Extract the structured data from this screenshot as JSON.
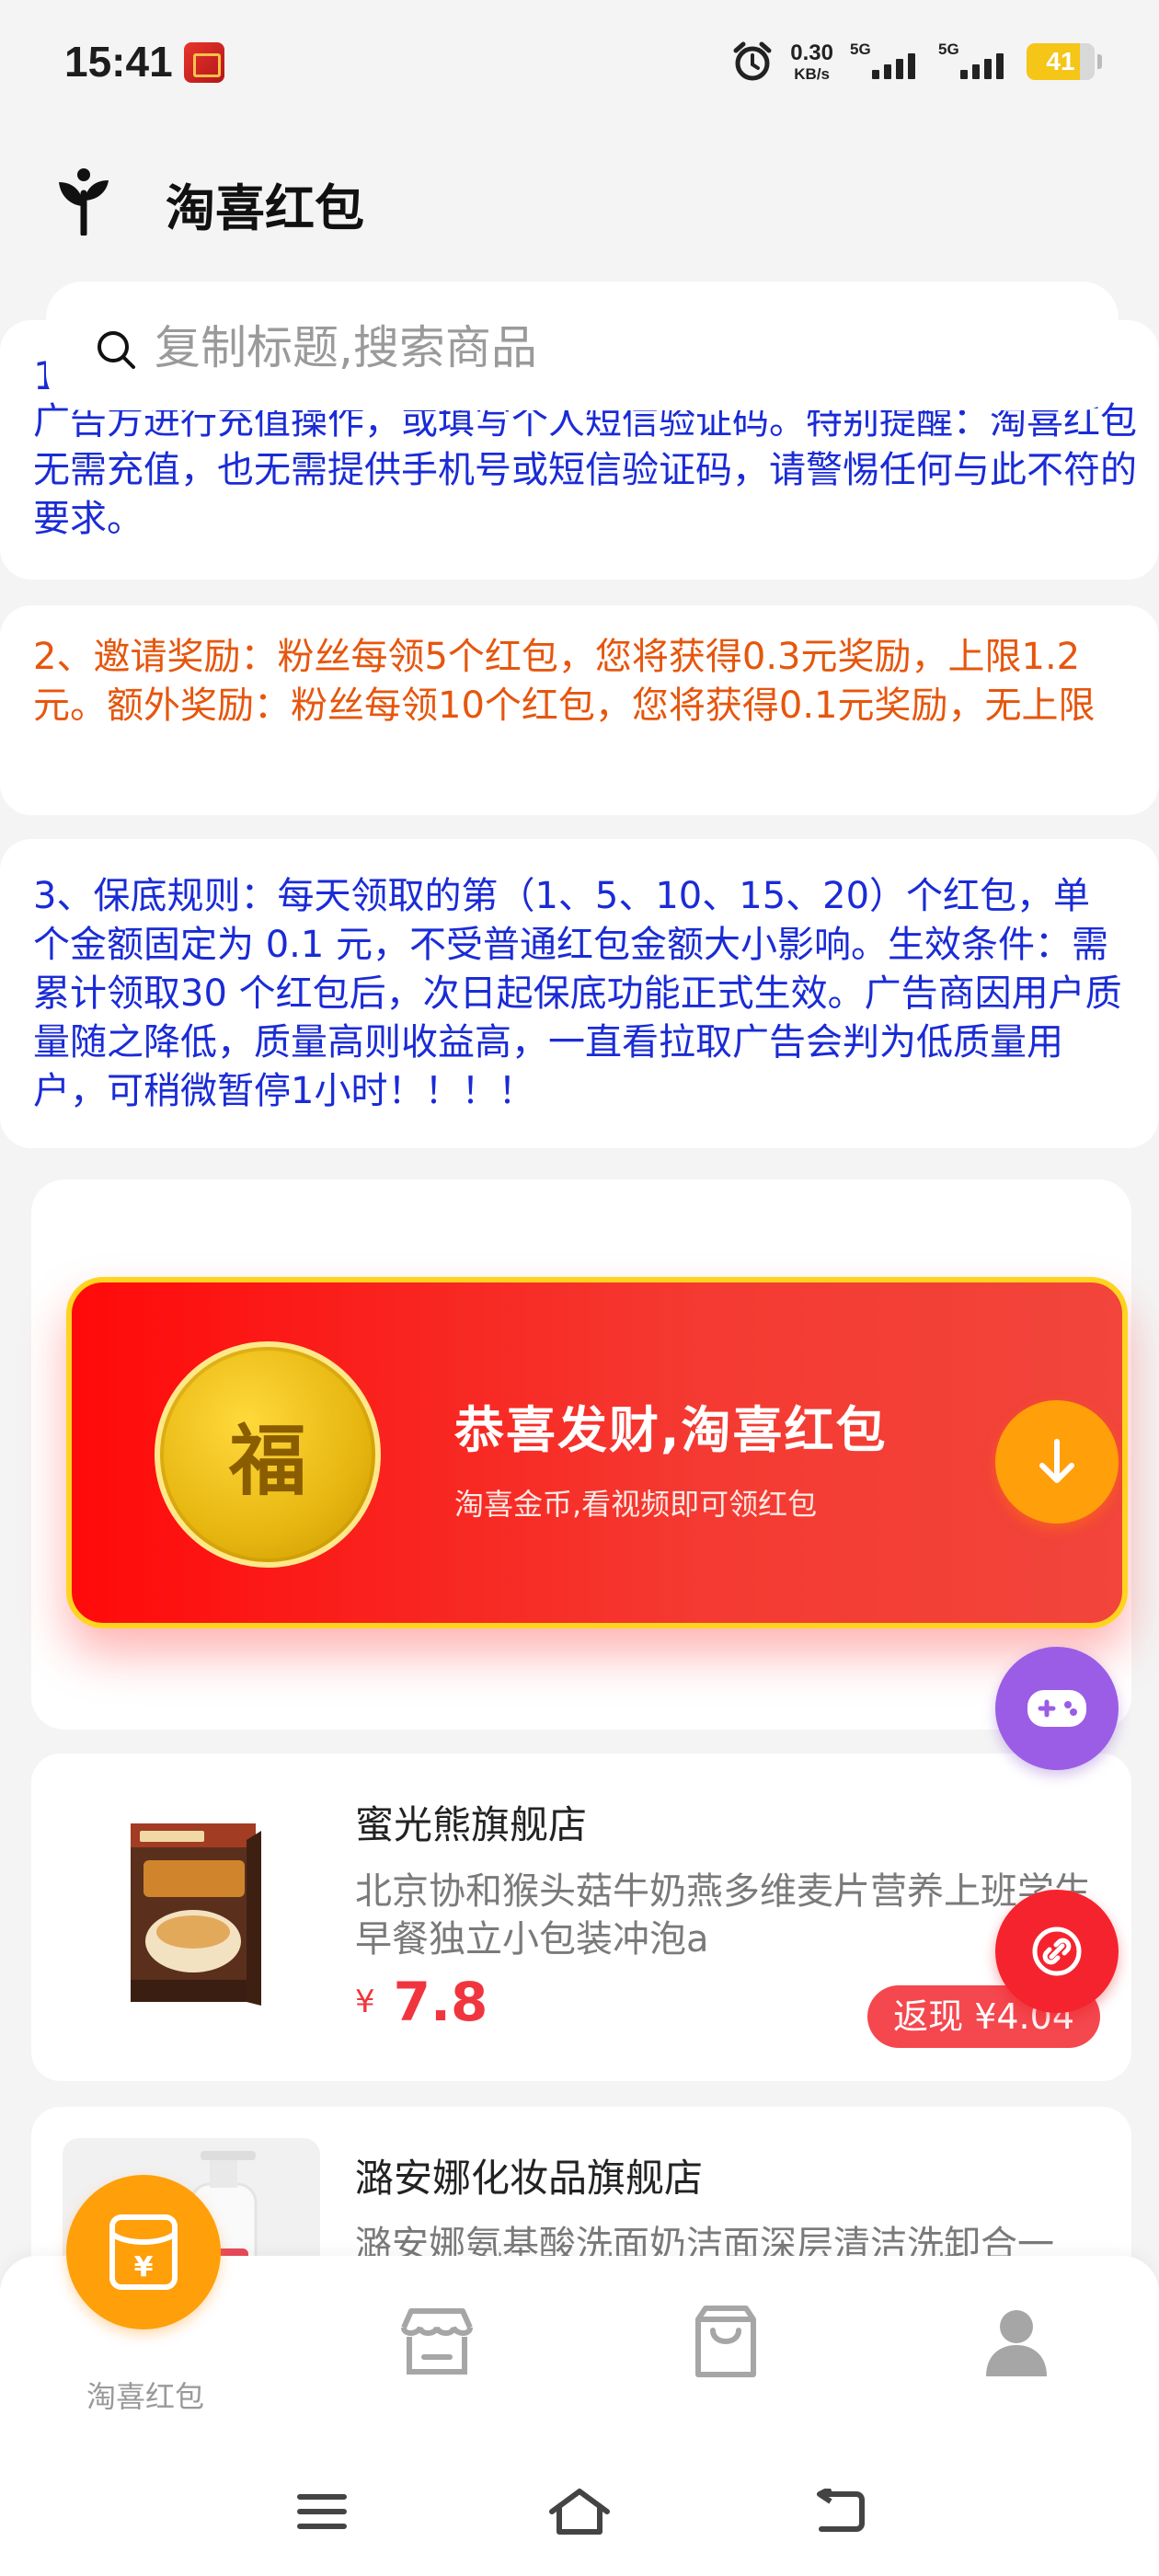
{
  "status_bar": {
    "time": "15:41",
    "net_speed_value": "0.30",
    "net_speed_unit": "KB/s",
    "sim1": "5G",
    "sim2": "5G",
    "battery": "41"
  },
  "header": {
    "title": "淘喜红包"
  },
  "search": {
    "placeholder": "复制标题,搜索商品"
  },
  "notices": [
    {
      "number": "1",
      "text": "广告方进行充值操作，或填写个人短信验证码。特别提醒：淘喜红包无需充值，也无需提供手机号或短信验证码，请警惕任何与此不符的要求。",
      "color": "#1a2bd6"
    },
    {
      "text": "2、邀请奖励：粉丝每领5个红包，您将获得0.3元奖励，上限1.2元。额外奖励：粉丝每领10个红包，您将获得0.1元奖励，无上限",
      "color": "#e6560d"
    },
    {
      "text": "3、保底规则：每天领取的第（1、5、10、15、20）个红包，单个金额固定为 0.1 元，不受普通红包金额大小影响。生效条件：需累计领取30 个红包后，次日起保底功能正式生效。广告商因用户质量随之降低，质量高则收益高，一直看拉取广告会判为低质量用户，可稍微暂停1小时！！！！",
      "color": "#1a2bd6"
    }
  ],
  "red_packet": {
    "coin_char": "福",
    "title": "恭喜发财,淘喜红包",
    "subtitle": "淘喜金币,看视频即可领红包"
  },
  "products": [
    {
      "shop": "蜜光熊旗舰店",
      "name": "北京协和猴头菇牛奶燕多维麦片营养上班学生早餐独立小包装冲泡a",
      "currency": "¥",
      "price": "7.8",
      "cashback": "返现 ¥4.04"
    },
    {
      "shop": "潞安娜化妆品旗舰店",
      "name": "潞安娜氨基酸洗面奶洁面深层清洁洗卸合一"
    }
  ],
  "bottom_nav": {
    "main_label": "淘喜红包",
    "main_icon_char": "¥"
  },
  "colors": {
    "accent_orange": "#ff9f0a",
    "red": "#f5232d",
    "purple": "#9b5de5",
    "notice_blue": "#1a2bd6",
    "notice_orange": "#e6560d"
  },
  "icons": [
    "alarm-icon",
    "signal-icon",
    "battery-icon",
    "logo-sprout-icon",
    "search-icon",
    "arrow-down-icon",
    "gamepad-icon",
    "link-icon",
    "red-packet-icon",
    "store-icon",
    "bag-icon",
    "user-icon",
    "menu-icon",
    "home-icon",
    "back-icon"
  ]
}
